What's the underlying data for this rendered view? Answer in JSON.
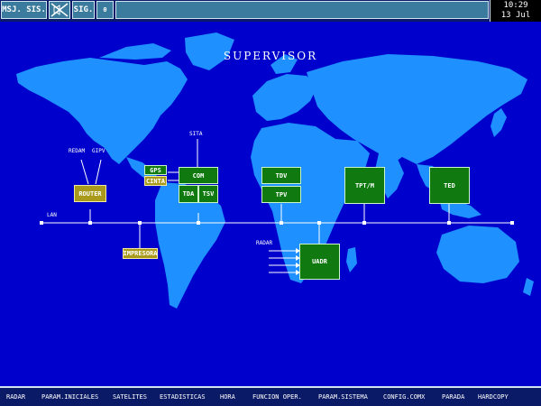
{
  "toolbar": {
    "msg_button": "MSJ. SIS.",
    "sig_button": "SIG.",
    "counter": "0"
  },
  "clock": {
    "time": "10:29",
    "date": "13 Jul"
  },
  "title": "SUPERVISOR",
  "labels": {
    "redam": "REDAM",
    "gipv": "GIPV",
    "sita": "SITA",
    "lan": "LAN",
    "radar": "RADAR"
  },
  "nodes": {
    "router": "ROUTER",
    "gps": "GPS",
    "cinta": "CINTA",
    "com": "COM",
    "tda": "TDA",
    "tsv": "TSV",
    "tdv": "TDV",
    "tpv": "TPV",
    "tpt": "TPT/M",
    "ted": "TED",
    "impresora": "IMPRESORA",
    "uadr": "UADR"
  },
  "menu": [
    "RADAR",
    "PARAM.INICIALES",
    "SATELITES",
    "ESTADISTICAS",
    "HORA",
    "FUNCION OPER.",
    "PARAM.SISTEMA",
    "CONFIG.COMX",
    "PARADA",
    "HARDCOPY"
  ],
  "colors": {
    "background": "#0000cc",
    "land": "#1e90ff",
    "node_green": "#107a10",
    "node_olive": "#a99a1c",
    "toolbar_button": "#3a7b9e"
  }
}
